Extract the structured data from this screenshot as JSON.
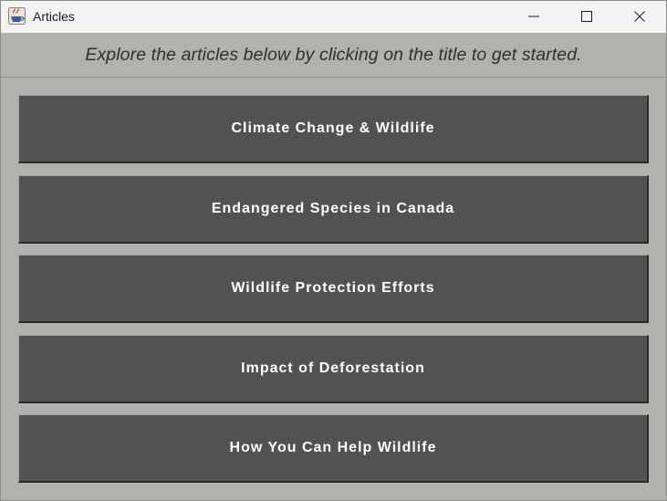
{
  "window": {
    "title": "Articles",
    "app_icon": "java-cup-icon",
    "controls": [
      "minimize-icon",
      "maximize-icon",
      "close-icon"
    ]
  },
  "header": {
    "text": "Explore the articles below by clicking on the title to get started."
  },
  "articles": [
    {
      "label": "Climate Change & Wildlife"
    },
    {
      "label": "Endangered Species in Canada"
    },
    {
      "label": "Wildlife Protection Efforts"
    },
    {
      "label": "Impact of Deforestation"
    },
    {
      "label": "How You Can Help Wildlife"
    }
  ],
  "colors": {
    "background": "#b3b1ae",
    "button": "#525252",
    "button_text": "#ffffff",
    "titlebar": "#f3f3f3"
  }
}
